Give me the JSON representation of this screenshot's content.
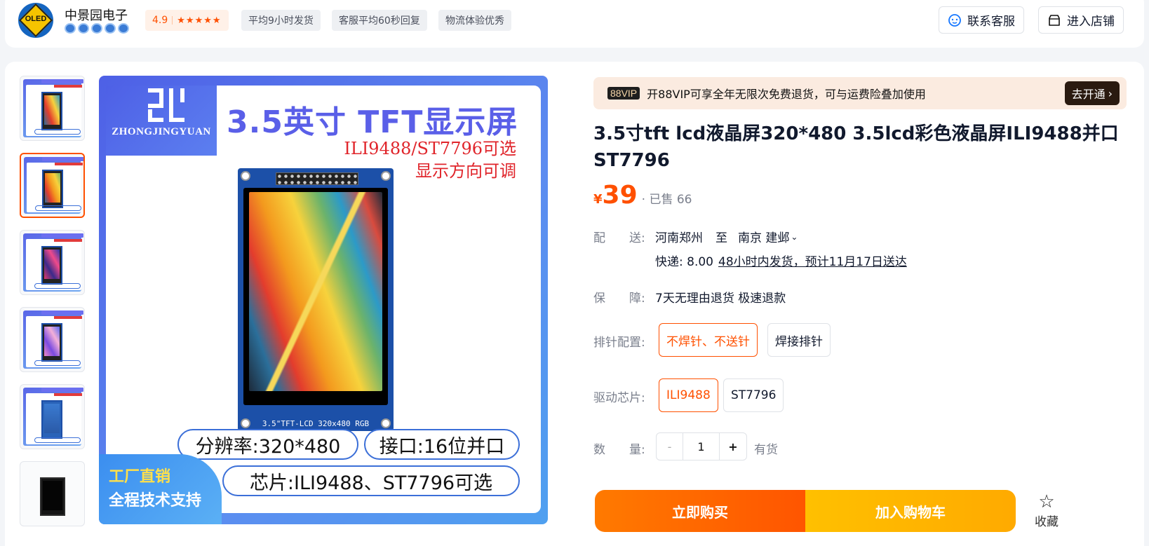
{
  "shop": {
    "logo_text": "OLED",
    "name": "中景园电子",
    "rating": "4.9",
    "stars": "★★★★★",
    "tags": [
      "平均9小时发货",
      "客服平均60秒回复",
      "物流体验优秀"
    ],
    "contact_label": "联系客服",
    "enter_label": "进入店铺"
  },
  "gallery": {
    "count": 6,
    "selected_index": 1,
    "main_image": {
      "brand": "ZHONGJINGYUAN",
      "title": "3.5英寸 TFT显示屏",
      "subtitle1": "ILI9488/ST7796可选",
      "subtitle2": "显示方向可调",
      "board_label": "3.5\"TFT-LCD 320x480 RGB",
      "spec_resolution": "分辨率:320*480",
      "spec_interface": "接口:16位并口",
      "spec_chip": "芯片:ILI9488、ST7796可选",
      "corner1": "工厂直销",
      "corner2": "全程技术支持"
    }
  },
  "vip": {
    "badge": "88VIP",
    "text": "开88VIP可享全年无限次免费退货，可与运费险叠加使用",
    "open_label": "去开通"
  },
  "product": {
    "title": "3.5寸tft lcd液晶屏320*480 3.5lcd彩色液晶屏ILI9488并口ST7796",
    "currency": "¥",
    "price": "39",
    "sold": "· 已售 66"
  },
  "delivery": {
    "label": "配　　送:",
    "from": "河南郑州",
    "to_word": "至",
    "to": "南京 建邺",
    "shipping": "快递: 8.00",
    "eta": "48小时内发货，预计11月17日送达"
  },
  "guarantee": {
    "label": "保　　障:",
    "value": "7天无理由退货 极速退款"
  },
  "options": {
    "pin": {
      "label": "排针配置:",
      "items": [
        "不焊针、不送针",
        "焊接排针"
      ],
      "selected": 0
    },
    "chip": {
      "label": "驱动芯片:",
      "items": [
        "ILI9488",
        "ST7796"
      ],
      "selected": 0
    }
  },
  "quantity": {
    "label": "数　　量:",
    "minus": "-",
    "value": "1",
    "plus": "+",
    "stock": "有货"
  },
  "actions": {
    "buy_now": "立即购买",
    "add_cart": "加入购物车",
    "favorite": "收藏"
  },
  "colors": {
    "accent": "#ff5000",
    "buy_gradient": "#ff6a00",
    "cart_gradient": "#ffb800",
    "vip_bg": "#fbebe0"
  }
}
